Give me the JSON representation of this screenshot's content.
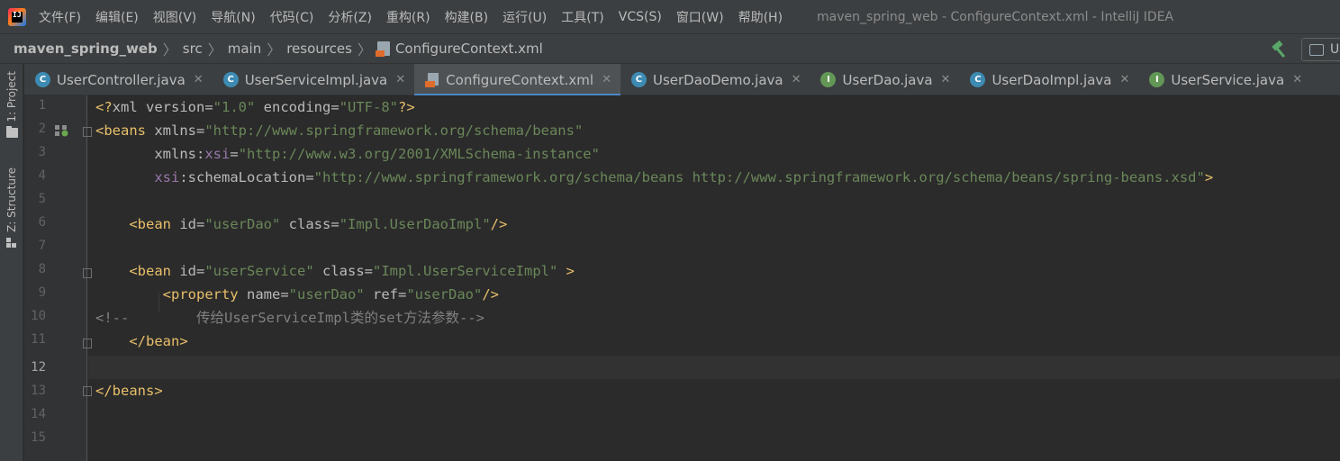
{
  "app": {
    "window_title": "maven_spring_web - ConfigureContext.xml - IntelliJ IDEA",
    "logo_text": "IJ"
  },
  "menu": [
    "文件(F)",
    "编辑(E)",
    "视图(V)",
    "导航(N)",
    "代码(C)",
    "分析(Z)",
    "重构(R)",
    "构建(B)",
    "运行(U)",
    "工具(T)",
    "VCS(S)",
    "窗口(W)",
    "帮助(H)"
  ],
  "breadcrumb": {
    "project": "maven_spring_web",
    "parts": [
      "src",
      "main",
      "resources"
    ],
    "file": "ConfigureContext.xml"
  },
  "toolbar": {
    "run_config_label": "U"
  },
  "tool_windows": {
    "project": "1: Project",
    "structure": "Z: Structure"
  },
  "tabs": [
    {
      "label": "UserController.java",
      "icon": "class-icon",
      "active": false
    },
    {
      "label": "UserServiceImpl.java",
      "icon": "class-icon",
      "active": false
    },
    {
      "label": "ConfigureContext.xml",
      "icon": "xml-icon",
      "active": true
    },
    {
      "label": "UserDaoDemo.java",
      "icon": "class-icon",
      "active": false
    },
    {
      "label": "UserDao.java",
      "icon": "interface-icon",
      "active": false
    },
    {
      "label": "UserDaoImpl.java",
      "icon": "class-icon",
      "active": false
    },
    {
      "label": "UserService.java",
      "icon": "interface-icon",
      "active": false
    }
  ],
  "editor": {
    "current_line": 12,
    "line_numbers": [
      "1",
      "2",
      "3",
      "4",
      "5",
      "6",
      "7",
      "8",
      "9",
      "10",
      "11",
      "12",
      "13",
      "14",
      "15"
    ],
    "code": {
      "l1_pi_open": "<?",
      "l1_pi_name": "xml version",
      "l1_eq1": "=",
      "l1_v1": "\"1.0\"",
      "l1_attr2": " encoding",
      "l1_eq2": "=",
      "l1_v2": "\"UTF-8\"",
      "l1_pi_close": "?>",
      "l2_tag": "<beans",
      "l2_attr": " xmlns",
      "l2_eq": "=",
      "l2_val": "\"http://www.springframework.org/schema/beans\"",
      "l3_indent": "       ",
      "l3_attr": "xmlns",
      "l3_colon": ":",
      "l3_ns": "xsi",
      "l3_eq": "=",
      "l3_val": "\"http://www.w3.org/2001/XMLSchema-instance\"",
      "l4_indent": "       ",
      "l4_ns": "xsi",
      "l4_colon": ":",
      "l4_attr": "schemaLocation",
      "l4_eq": "=",
      "l4_val": "\"http://www.springframework.org/schema/beans http://www.springframework.org/schema/beans/spring-beans.xsd\"",
      "l4_close": ">",
      "l6_indent": "    ",
      "l6_tag": "<bean",
      "l6_attr1": " id",
      "l6_eq1": "=",
      "l6_v1": "\"userDao\"",
      "l6_attr2": " class",
      "l6_eq2": "=",
      "l6_v2": "\"Impl.UserDaoImpl\"",
      "l6_close": "/>",
      "l8_indent": "    ",
      "l8_tag": "<bean",
      "l8_attr1": " id",
      "l8_eq1": "=",
      "l8_v1": "\"userService\"",
      "l8_attr2": " class",
      "l8_eq2": "=",
      "l8_v2": "\"Impl.UserServiceImpl\"",
      "l8_close": " >",
      "l9_indent": "        ",
      "l9_tag": "<property",
      "l9_attr1": " name",
      "l9_eq1": "=",
      "l9_v1": "\"userDao\"",
      "l9_attr2": " ref",
      "l9_eq2": "=",
      "l9_v2": "\"userDao\"",
      "l9_close": "/>",
      "l10_comment": "<!--        传给UserServiceImpl类的set方法参数-->",
      "l11_indent": "    ",
      "l11_tag": "</bean>",
      "l13_tag": "</beans>"
    }
  }
}
